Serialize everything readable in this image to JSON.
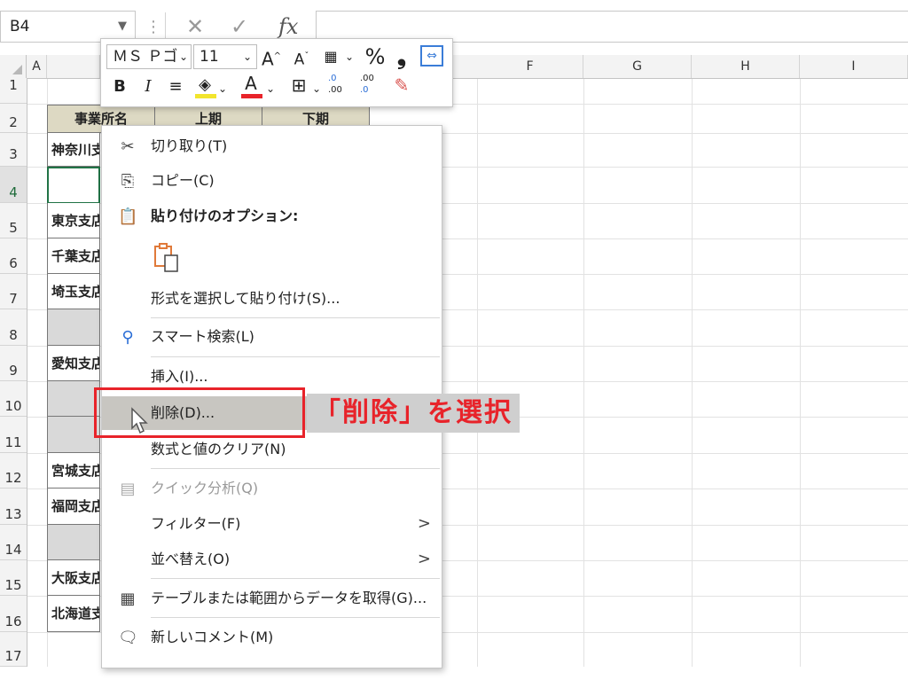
{
  "formula_bar": {
    "name_box": "B4",
    "cancel_glyph": "✕",
    "enter_glyph": "✓",
    "fx_label": "fx",
    "formula_value": ""
  },
  "columns": [
    "A",
    "E",
    "F",
    "G",
    "H",
    "I"
  ],
  "rows": [
    "1",
    "2",
    "3",
    "4",
    "5",
    "6",
    "7",
    "8",
    "9",
    "10",
    "11",
    "12",
    "13",
    "14",
    "15",
    "16",
    "17"
  ],
  "table": {
    "headers": [
      "事業所名",
      "上期",
      "下期"
    ],
    "cells": [
      "神奈川支",
      "",
      "東京支店",
      "千葉支店",
      "埼玉支店",
      "",
      "愛知支店",
      "",
      "",
      "宮城支店",
      "福岡支店",
      "",
      "大阪支店",
      "北海道支"
    ]
  },
  "mini_toolbar": {
    "font_name": "ＭＳ Ｐゴ",
    "font_size": "11",
    "grow_font": "A",
    "shrink_font": "A",
    "percent": "%",
    "comma": "❟",
    "bold": "B",
    "italic": "I",
    "font_color_letter": "A",
    "inc_decimal_top": ".0",
    "inc_decimal_bottom": ".00",
    "dec_decimal_top": ".00",
    "dec_decimal_bottom": ".0",
    "fill_color": "#f2e52d",
    "font_color": "#e8232a"
  },
  "context_menu": {
    "items": [
      {
        "label": "切り取り(T)",
        "icon": "scissors-icon"
      },
      {
        "label": "コピー(C)",
        "icon": "copy-icon"
      },
      {
        "label": "貼り付けのオプション:",
        "icon": "paste-icon"
      },
      {
        "label": "形式を選択して貼り付け(S)..."
      },
      {
        "label": "スマート検索(L)",
        "icon": "smart-lookup-icon"
      },
      {
        "label": "挿入(I)..."
      },
      {
        "label": "削除(D)..."
      },
      {
        "label": "数式と値のクリア(N)"
      },
      {
        "label": "クイック分析(Q)",
        "icon": "quick-analysis-icon"
      },
      {
        "label": "フィルター(F)"
      },
      {
        "label": "並べ替え(O)"
      },
      {
        "label": "テーブルまたは範囲からデータを取得(G)...",
        "icon": "table-icon"
      },
      {
        "label": "新しいコメント(M)",
        "icon": "comment-icon"
      }
    ],
    "submenu_arrow": ">"
  },
  "annotation": {
    "text": "「削除」を選択",
    "color": "#e8232a"
  }
}
